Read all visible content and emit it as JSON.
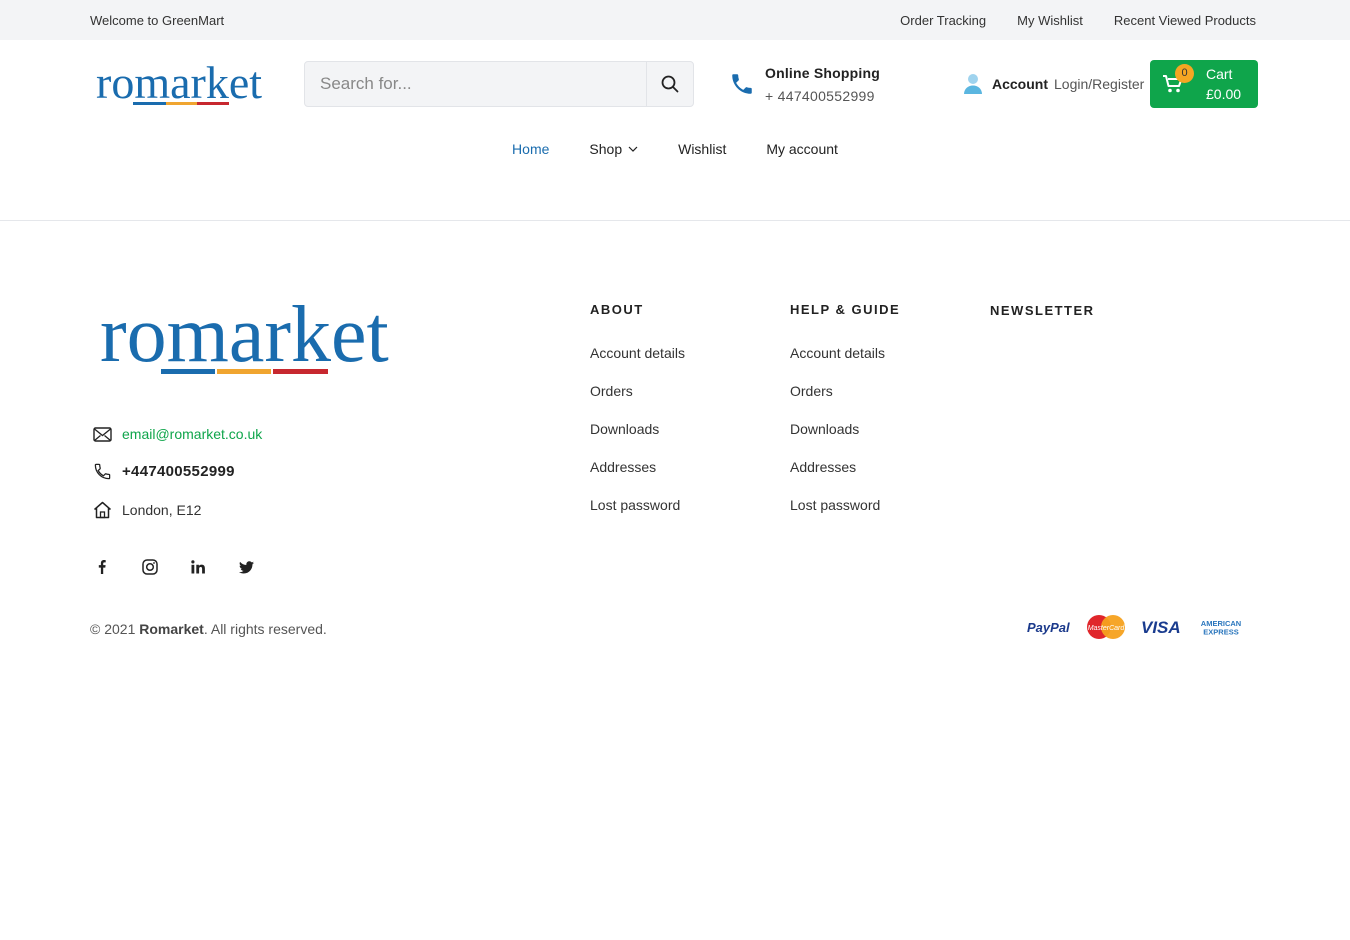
{
  "topbar": {
    "welcome": "Welcome to GreenMart",
    "links": [
      "Order Tracking",
      "My Wishlist",
      "Recent Viewed Products"
    ]
  },
  "header": {
    "logo_text": "romarket",
    "search_placeholder": "Search for...",
    "phone_title": "Online Shopping",
    "phone_number": "+ 447400552999",
    "account_label": "Account",
    "account_login": "Login/Register",
    "cart_label": "Cart",
    "cart_total": "£0.00",
    "cart_count": "0"
  },
  "nav": {
    "items": [
      "Home",
      "Shop",
      "Wishlist",
      "My account"
    ]
  },
  "footer": {
    "logo_text": "romarket",
    "email": "email@romarket.co.uk",
    "phone": "+447400552999",
    "address": "London, E12",
    "about": {
      "title": "ABOUT",
      "links": [
        "Account details",
        "Orders",
        "Downloads",
        "Addresses",
        "Lost password"
      ]
    },
    "help": {
      "title": "HELP & GUIDE",
      "links": [
        "Account details",
        "Orders",
        "Downloads",
        "Addresses",
        "Lost password"
      ]
    },
    "newsletter_title": "NEWSLETTER",
    "copyright_prefix": "© 2021",
    "copyright_brand": "Romarket",
    "copyright_suffix": ". All rights reserved.",
    "payments": [
      "PayPal",
      "MasterCard",
      "VISA",
      "AMERICAN EXPRESS"
    ]
  },
  "colors": {
    "brand_blue": "#1a6cae",
    "green": "#0fa54b",
    "badge": "#f5a623",
    "stripe_orange": "#f0a530",
    "stripe_red": "#c7282f"
  },
  "icons": {
    "social": [
      "facebook-icon",
      "instagram-icon",
      "linkedin-icon",
      "twitter-icon"
    ]
  }
}
